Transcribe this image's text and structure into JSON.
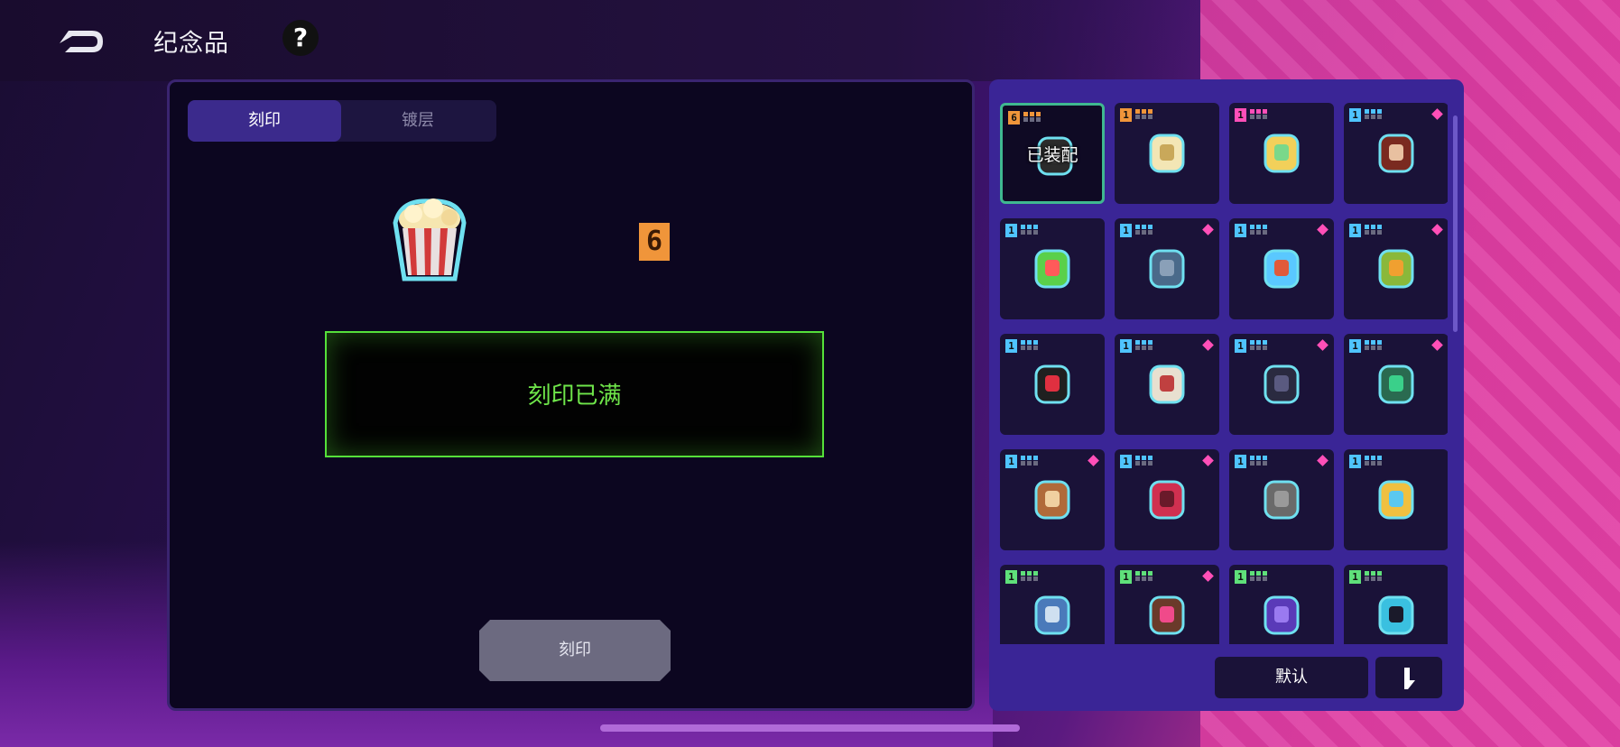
{
  "header": {
    "title": "纪念品",
    "help_label": "?"
  },
  "left_panel": {
    "tabs": [
      {
        "label": "刻印",
        "active": true
      },
      {
        "label": "镀层",
        "active": false
      }
    ],
    "item_icon": "popcorn-icon",
    "level": "6",
    "status_text": "刻印已满",
    "engrave_button": "刻印"
  },
  "right_panel": {
    "equipped_label": "已装配",
    "default_button": "默认",
    "slots": [
      {
        "rank": "6",
        "rank_color": "#f0953a",
        "icon": "dark-cape-icon",
        "equipped": true,
        "new": false
      },
      {
        "rank": "1",
        "rank_color": "#f0953a",
        "icon": "fang-icon",
        "equipped": false,
        "new": false
      },
      {
        "rank": "1",
        "rank_color": "#ff4fb8",
        "icon": "ice-cream-icon",
        "equipped": false,
        "new": false
      },
      {
        "rank": "1",
        "rank_color": "#4fc4ff",
        "icon": "cake-icon",
        "equipped": false,
        "new": true
      },
      {
        "rank": "1",
        "rank_color": "#4fc4ff",
        "icon": "clown-potion-icon",
        "equipped": false,
        "new": false
      },
      {
        "rank": "1",
        "rank_color": "#4fc4ff",
        "icon": "axe-icon",
        "equipped": false,
        "new": true
      },
      {
        "rank": "1",
        "rank_color": "#4fc4ff",
        "icon": "dagger-icon",
        "equipped": false,
        "new": true
      },
      {
        "rank": "1",
        "rank_color": "#4fc4ff",
        "icon": "gear-amulet-icon",
        "equipped": false,
        "new": true
      },
      {
        "rank": "1",
        "rank_color": "#4fc4ff",
        "icon": "red-eye-orb-icon",
        "equipped": false,
        "new": false
      },
      {
        "rank": "1",
        "rank_color": "#4fc4ff",
        "icon": "scroll-icon",
        "equipped": false,
        "new": true
      },
      {
        "rank": "1",
        "rank_color": "#4fc4ff",
        "icon": "demon-helmet-icon",
        "equipped": false,
        "new": true
      },
      {
        "rank": "1",
        "rank_color": "#4fc4ff",
        "icon": "green-mask-icon",
        "equipped": false,
        "new": true
      },
      {
        "rank": "1",
        "rank_color": "#4fc4ff",
        "icon": "hourglass-icon",
        "equipped": false,
        "new": true
      },
      {
        "rank": "1",
        "rank_color": "#4fc4ff",
        "icon": "crowbar-icon",
        "equipped": false,
        "new": true
      },
      {
        "rank": "1",
        "rank_color": "#4fc4ff",
        "icon": "gauntlet-icon",
        "equipped": false,
        "new": true
      },
      {
        "rank": "1",
        "rank_color": "#4fc4ff",
        "icon": "ticket-icon",
        "equipped": false,
        "new": false
      },
      {
        "rank": "1",
        "rank_color": "#5fe07a",
        "icon": "shark-icon",
        "equipped": false,
        "new": false
      },
      {
        "rank": "1",
        "rank_color": "#5fe07a",
        "icon": "cookie-icon",
        "equipped": false,
        "new": true
      },
      {
        "rank": "1",
        "rank_color": "#5fe07a",
        "icon": "planet-orb-icon",
        "equipped": false,
        "new": false
      },
      {
        "rank": "1",
        "rank_color": "#5fe07a",
        "icon": "sunglasses-icon",
        "equipped": false,
        "new": false
      }
    ]
  }
}
